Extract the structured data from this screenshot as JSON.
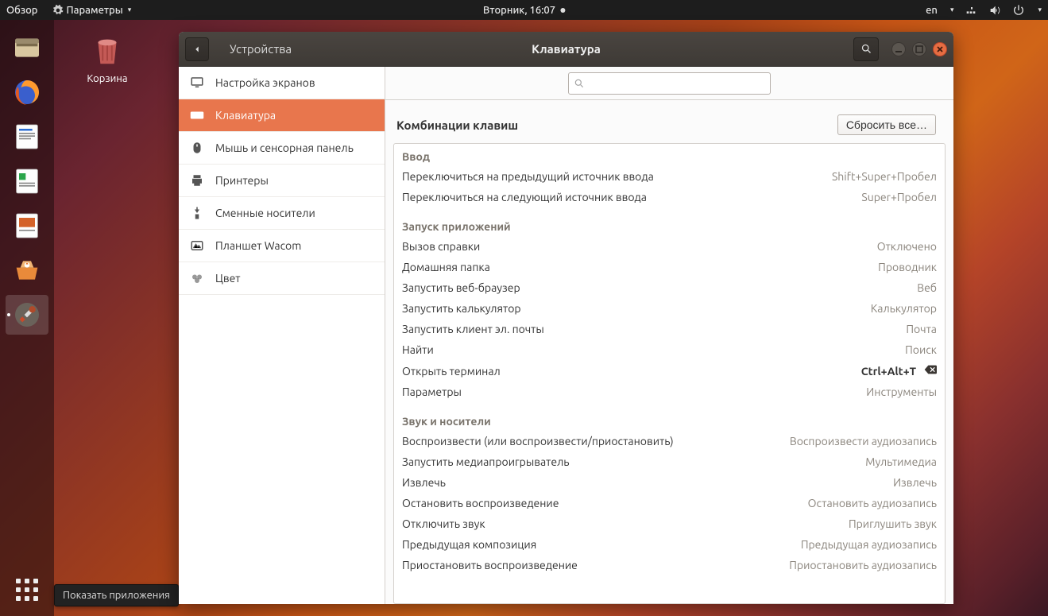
{
  "topbar": {
    "overview": "Обзор",
    "params": "Параметры",
    "datetime": "Вторник, 16:07",
    "lang": "en"
  },
  "desktop": {
    "trash_label": "Корзина"
  },
  "dock_tooltip": "Показать приложения",
  "window": {
    "section": "Устройства",
    "title": "Клавиатура",
    "reset": "Сбросить все…",
    "search_placeholder": ""
  },
  "sidebar": {
    "items": [
      {
        "label": "Настройка экранов"
      },
      {
        "label": "Клавиатура"
      },
      {
        "label": "Мышь и сенсорная панель"
      },
      {
        "label": "Принтеры"
      },
      {
        "label": "Сменные носители"
      },
      {
        "label": "Планшет Wacom"
      },
      {
        "label": "Цвет"
      }
    ]
  },
  "content": {
    "heading": "Комбинации клавиш",
    "groups": [
      {
        "title": "Ввод",
        "rows": [
          {
            "label": "Переключиться на предыдущий источник ввода",
            "value": "Shift+Super+Пробел"
          },
          {
            "label": "Переключиться на следующий источник ввода",
            "value": "Super+Пробел"
          }
        ]
      },
      {
        "title": "Запуск приложений",
        "rows": [
          {
            "label": "Вызов справки",
            "value": "Отключено"
          },
          {
            "label": "Домашняя папка",
            "value": "Проводник"
          },
          {
            "label": "Запустить веб-браузер",
            "value": "Веб"
          },
          {
            "label": "Запустить калькулятор",
            "value": "Калькулятор"
          },
          {
            "label": "Запустить клиент эл. почты",
            "value": "Почта"
          },
          {
            "label": "Найти",
            "value": "Поиск"
          },
          {
            "label": "Открыть терминал",
            "value": "Ctrl+Alt+T",
            "strong": true,
            "deletable": true
          },
          {
            "label": "Параметры",
            "value": "Инструменты"
          }
        ]
      },
      {
        "title": "Звук и носители",
        "rows": [
          {
            "label": "Воспроизвести (или воспроизвести/приостановить)",
            "value": "Воспроизвести аудиозапись"
          },
          {
            "label": "Запустить медиапроигрыватель",
            "value": "Мультимедиа"
          },
          {
            "label": "Извлечь",
            "value": "Извлечь"
          },
          {
            "label": "Остановить воспроизведение",
            "value": "Остановить аудиозапись"
          },
          {
            "label": "Отключить звук",
            "value": "Приглушить звук"
          },
          {
            "label": "Предыдущая композиция",
            "value": "Предыдущая аудиозапись"
          },
          {
            "label": "Приостановить воспроизведение",
            "value": "Приостановить аудиозапись"
          }
        ]
      }
    ]
  }
}
